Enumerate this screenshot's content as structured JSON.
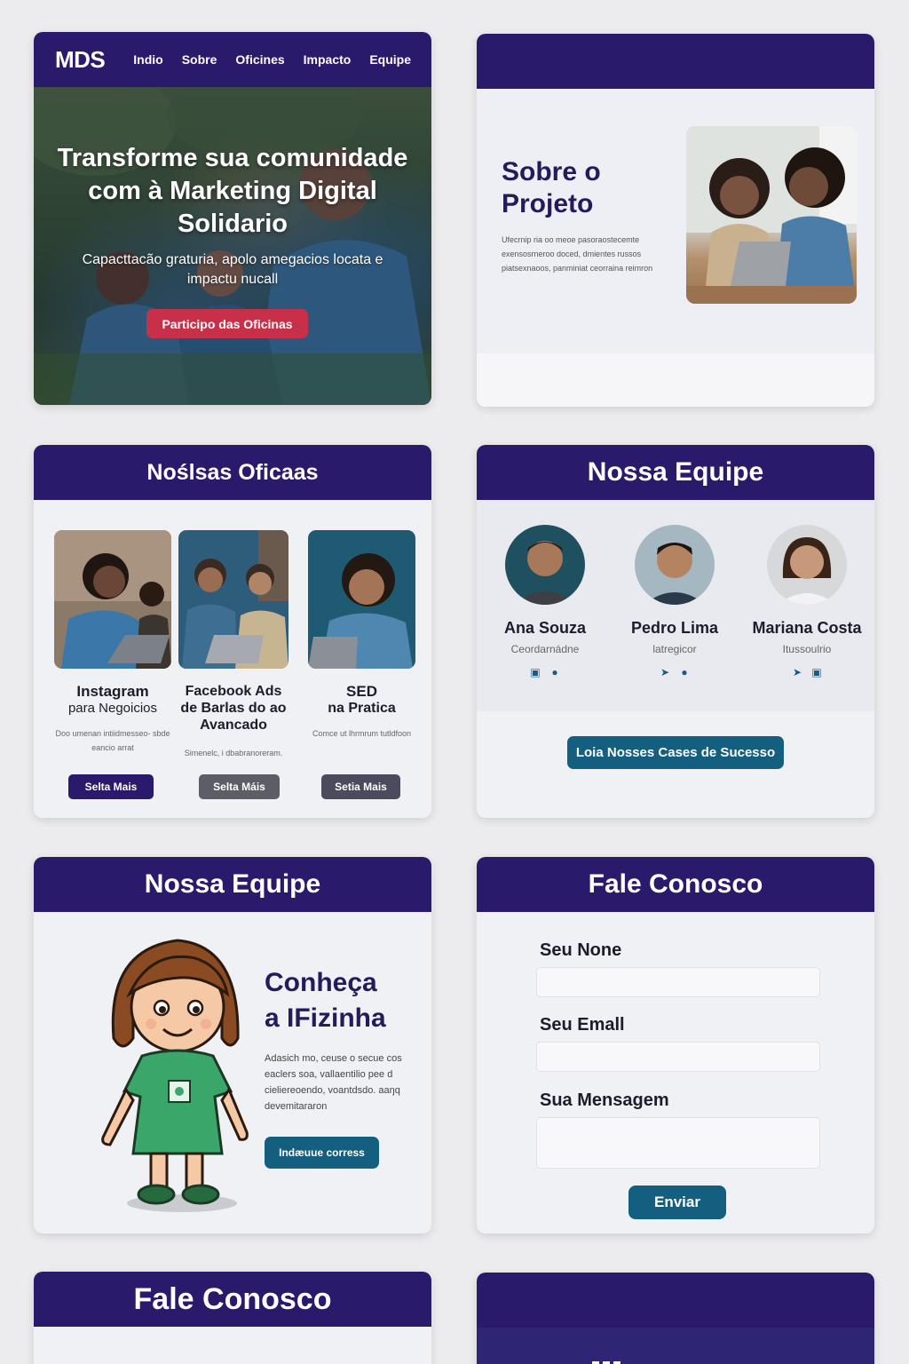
{
  "hero": {
    "logo": "MDS",
    "nav": [
      "Indio",
      "Sobre",
      "Oficines",
      "Impacto",
      "Equipe"
    ],
    "title": "Transforme sua comunidade com à Marketing Digital Solidario",
    "subtitle": "Capacttacão graturia, apolo amegacios locata e impactu nucall",
    "cta": "Participo das Oficinas"
  },
  "sobre": {
    "title": "Sobre o Projeto",
    "text": "Ufecrnip ria oo meoe pasoraostecemte exensosrneroo doced, dmientes russos piatsexnaoos, panminiat ceorraina reimron"
  },
  "oficinas": {
    "heading": "Noślsas Oficaas",
    "items": [
      {
        "title": "Instagram",
        "subtitle": "para Negoicios",
        "desc": "Doo umenan intiidmesseo- sbde eancio arrat",
        "button": "Selta Mais",
        "button_color": "#2a1a6b"
      },
      {
        "title": "Facebook Ads de Barlas do ao Avancado",
        "subtitle": "",
        "desc": "Simenelc, i dbabranoreram.",
        "button": "Selta Máis",
        "button_color": "#5d5d66"
      },
      {
        "title": "SED",
        "subtitle": "na Pratica",
        "desc": "Comce ut lhrmrum tutldfoon",
        "button": "Setia Mais",
        "button_color": "#4b4b5e"
      }
    ]
  },
  "equipe": {
    "heading": "Nossa Equipe",
    "members": [
      {
        "name": "Ana Souza",
        "role": "Ceordarnádne",
        "icons": [
          "lock-icon",
          "chat-icon"
        ]
      },
      {
        "name": "Pedro Lima",
        "role": "latregicor",
        "icons": [
          "twitter-icon",
          "telegram-icon"
        ]
      },
      {
        "name": "Mariana Costa",
        "role": "Itussoulrio",
        "icons": [
          "twitter-icon",
          "instagram-icon"
        ]
      }
    ],
    "cta": "Loia Nosses Cases de Sucesso"
  },
  "fizinha": {
    "heading": "Nossa Equipe",
    "title": "Conheça a IFizinha",
    "text": "Adasich mo, ceuse o secue cos eaclers soa, vallaentilio pee d cieliereoendo, voantdsdo. aaŋq devemitararon",
    "button": "Indæuue corress"
  },
  "contato": {
    "heading": "Fale Conosco",
    "name_label": "Seu None",
    "email_label": "Seu Emall",
    "message_label": "Sua Mensagem",
    "submit": "Enviar"
  },
  "fale2": {
    "heading": "Fale Conosco"
  },
  "colors": {
    "header": "#2a1a6b",
    "accent_red": "#c8304a",
    "accent_teal": "#145e80",
    "bg": "#ececee"
  }
}
